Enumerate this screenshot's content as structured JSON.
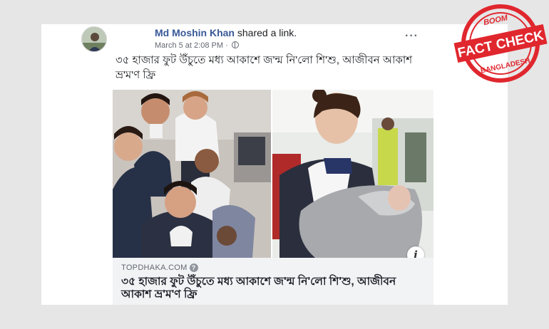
{
  "post": {
    "author": "Md Moshin Khan",
    "action": " shared a link.",
    "date": "March 5 at 2:08 PM",
    "separator": "·",
    "more_label": "···",
    "text": "৩৫ হাজার ফুট উঁচুতে মধ্য আকাশে জ'ন্ম নি'লো শি'শু, আজীবন আকাশ ভ্র'ম'ণ ফ্রি"
  },
  "link_preview": {
    "domain": "TOPDHAKA.COM",
    "help_label": "?",
    "title": "৩৫ হাজার ফুট উঁচুতে মধ্য আকাশে জ'ন্ম নি'লো শি'শু, আজীবন আকাশ ভ্র'ম'ণ ফ্রি",
    "info_label": "i"
  },
  "badge": {
    "top_text": "BOOM",
    "main_text": "FACT CHECK",
    "bottom_text": "BANGLADESH"
  },
  "colors": {
    "background": "#e6e6e6",
    "author_blue": "#385898",
    "badge_red": "#e0272e",
    "link_box": "#f2f3f5"
  },
  "icons": [
    "avatar",
    "globe-icon",
    "more-icon",
    "info-icon",
    "help-icon",
    "fact-check-badge"
  ]
}
